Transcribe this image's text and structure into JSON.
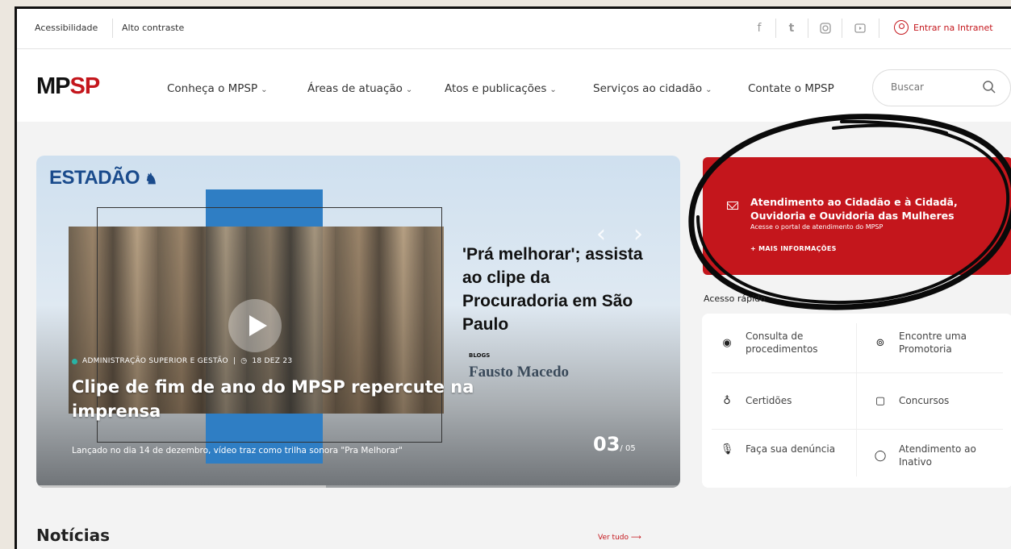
{
  "utility": {
    "accessibility": "Acessibilidade",
    "high_contrast": "Alto contraste",
    "social_icons": [
      "facebook-icon",
      "twitter-icon",
      "instagram-icon",
      "youtube-icon"
    ],
    "intranet_label": "Entrar na Intranet"
  },
  "nav": {
    "logo_mp": "MP",
    "logo_sp": "SP",
    "items": [
      {
        "label": "Conheça o MPSP",
        "chevron": "⌄"
      },
      {
        "label": "Áreas de atuação",
        "chevron": "⌄"
      },
      {
        "label": "Atos e publicações",
        "chevron": "⌄"
      },
      {
        "label": "Serviços ao cidadão",
        "chevron": "⌄"
      },
      {
        "label": "Contate o MPSP",
        "chevron": ""
      }
    ],
    "search_placeholder": "Buscar"
  },
  "hero": {
    "brand": "ESTADÃO",
    "headline": "'Prá melhorar'; assista ao clipe da Procuradoria em São Paulo",
    "blog_tag": "BLOGS",
    "blog_name": "Fausto Macedo",
    "category": "ADMINISTRAÇÃO SUPERIOR E GESTÃO",
    "date": "18 DEZ 23",
    "title": "Clipe de fim de ano do MPSP repercute na imprensa",
    "subtitle": "Lançado no dia 14 de dezembro, vídeo traz como trilha sonora \"Pra Melhorar\"",
    "slide_current": "03",
    "slide_total": "/ 05",
    "prev_arrow": "‹",
    "next_arrow": "›",
    "progress": 0.45
  },
  "attendance": {
    "title": "Atendimento ao Cidadão e à Cidadã, Ouvidoria e Ouvidoria das Mulheres",
    "description": "Acesse o portal de atendimento do MPSP",
    "more": "+ MAIS INFORMAÇÕES"
  },
  "quick_access": {
    "label": "Acesso rápido",
    "items": [
      {
        "label": "Consulta de procedimentos",
        "icon": "eye-icon",
        "glyph": "◉"
      },
      {
        "label": "Encontre uma Promotoria",
        "icon": "location-pin-icon",
        "glyph": "⊚"
      },
      {
        "label": "Certidões",
        "icon": "certificate-icon",
        "glyph": "♁"
      },
      {
        "label": "Concursos",
        "icon": "briefcase-icon",
        "glyph": "▢"
      },
      {
        "label": "Faça sua denúncia",
        "icon": "microphone-icon",
        "glyph": "🎙"
      },
      {
        "label": "Atendimento ao Inativo",
        "icon": "chat-bubble-icon",
        "glyph": "◯"
      }
    ]
  },
  "news": {
    "heading": "Notícias",
    "see_all": "Ver tudo ⟶"
  },
  "colors": {
    "brand_red": "#c4161c",
    "estadao_blue": "#1a4b8c",
    "tag_teal": "#28b3a5"
  }
}
